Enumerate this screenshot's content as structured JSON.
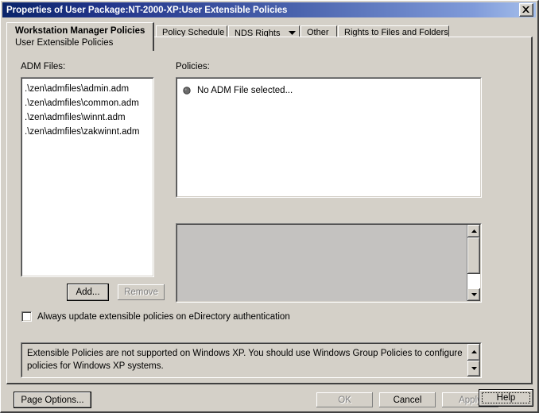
{
  "window": {
    "title": "Properties of User Package:NT-2000-XP:User Extensible Policies",
    "close_icon": "close-icon"
  },
  "tabs": [
    {
      "id": "workstation-manager-policies",
      "line1": "Workstation Manager Policies",
      "line2": "User Extensible Policies",
      "active": true,
      "has_dropdown": false
    },
    {
      "id": "policy-schedule",
      "label": "Policy Schedule",
      "active": false,
      "has_dropdown": false
    },
    {
      "id": "nds-rights",
      "label": "NDS Rights",
      "active": false,
      "has_dropdown": true,
      "dropdown_icon": "chevron-down-icon"
    },
    {
      "id": "other",
      "label": "Other",
      "active": false,
      "has_dropdown": false
    },
    {
      "id": "rights-to-files-and-folders",
      "label": "Rights to Files and Folders",
      "active": false,
      "has_dropdown": false
    }
  ],
  "adm": {
    "label": "ADM Files:",
    "files": [
      ".\\zen\\admfiles\\admin.adm",
      ".\\zen\\admfiles\\common.adm",
      ".\\zen\\admfiles\\winnt.adm",
      ".\\zen\\admfiles\\zakwinnt.adm"
    ],
    "add_label": "Add...",
    "remove_label": "Remove",
    "remove_enabled": false
  },
  "policies": {
    "label": "Policies:",
    "items": [
      {
        "icon": "policy-bullet-icon",
        "text": "No ADM File selected..."
      }
    ]
  },
  "detail_pane": {
    "text": "",
    "enabled": false,
    "scroll_up_icon": "scroll-up-icon",
    "scroll_down_icon": "scroll-down-icon"
  },
  "checkbox": {
    "label": "Always update extensible policies on eDirectory authentication",
    "checked": false
  },
  "warning": {
    "text": "Extensible Policies are not supported on Windows XP.  You should use Windows Group Policies to configure policies for Windows XP systems.",
    "scroll_up_icon": "scroll-up-icon",
    "scroll_down_icon": "scroll-down-icon"
  },
  "footer": {
    "page_options_label": "Page Options...",
    "ok_label": "OK",
    "ok_enabled": false,
    "cancel_label": "Cancel",
    "cancel_enabled": true,
    "apply_label": "Apply",
    "apply_enabled": false,
    "help_label": "Help",
    "help_focused": true
  },
  "colors": {
    "dialog_background": "#d4d0c8",
    "titlebar_start": "#0a246a",
    "titlebar_end": "#a6c0ec",
    "titlebar_text": "#ffffff",
    "disabled_text": "#808080",
    "detail_pane_background": "#c4c2c0"
  }
}
